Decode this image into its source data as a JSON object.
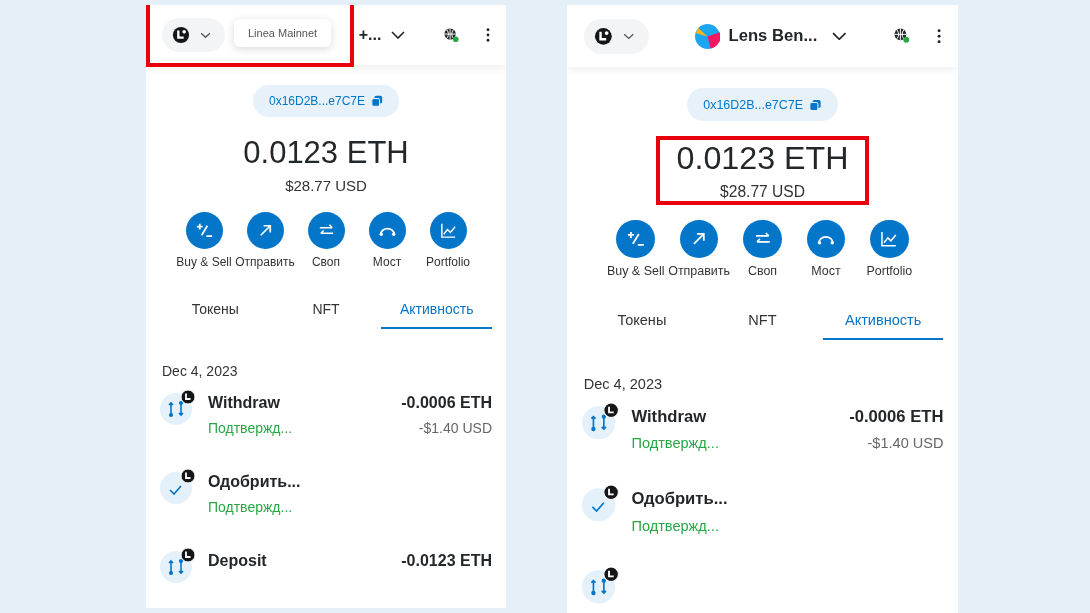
{
  "panels": [
    {
      "network_highlighted": true,
      "balance_highlighted": false,
      "network_tooltip": "Linea Mainnet",
      "account": {
        "name": "+...",
        "avatar": false
      },
      "address": "0x16D2B...e7C7E",
      "balance": "0.0123 ETH",
      "fiat": "$28.77 USD",
      "actions": [
        {
          "kind": "buy-sell",
          "label": "Buy & Sell"
        },
        {
          "kind": "send",
          "label": "Отправить"
        },
        {
          "kind": "swap",
          "label": "Своп"
        },
        {
          "kind": "bridge",
          "label": "Мост"
        },
        {
          "kind": "portfolio",
          "label": "Portfolio"
        }
      ],
      "tabs": [
        {
          "label": "Токены",
          "selected": false
        },
        {
          "label": "NFT",
          "selected": false
        },
        {
          "label": "Активность",
          "selected": true
        }
      ],
      "date": "Dec 4, 2023",
      "activity": [
        {
          "kind": "swap",
          "name": "Withdraw",
          "status": "Подтвержд...",
          "amount": "-0.0006 ETH",
          "fiat": "-$1.40 USD"
        },
        {
          "kind": "approve",
          "name": "Одобрить...",
          "status": "Подтвержд..."
        },
        {
          "kind": "swap",
          "name": "Deposit",
          "amount": "-0.0123 ETH"
        }
      ]
    },
    {
      "network_highlighted": false,
      "balance_highlighted": true,
      "account": {
        "name": "Lens Ben...",
        "avatar": true
      },
      "address": "0x16D2B...e7C7E",
      "balance": "0.0123 ETH",
      "fiat": "$28.77 USD",
      "actions": [
        {
          "kind": "buy-sell",
          "label": "Buy & Sell"
        },
        {
          "kind": "send",
          "label": "Отправить"
        },
        {
          "kind": "swap",
          "label": "Своп"
        },
        {
          "kind": "bridge",
          "label": "Мост"
        },
        {
          "kind": "portfolio",
          "label": "Portfolio"
        }
      ],
      "tabs": [
        {
          "label": "Токены",
          "selected": false
        },
        {
          "label": "NFT",
          "selected": false
        },
        {
          "label": "Активность",
          "selected": true
        }
      ],
      "date": "Dec 4, 2023",
      "activity": [
        {
          "kind": "swap",
          "name": "Withdraw",
          "status": "Подтвержд...",
          "amount": "-0.0006 ETH",
          "fiat": "-$1.40 USD"
        },
        {
          "kind": "approve",
          "name": "Одобрить...",
          "status": "Подтвержд..."
        },
        {
          "kind": "swap"
        }
      ]
    }
  ]
}
